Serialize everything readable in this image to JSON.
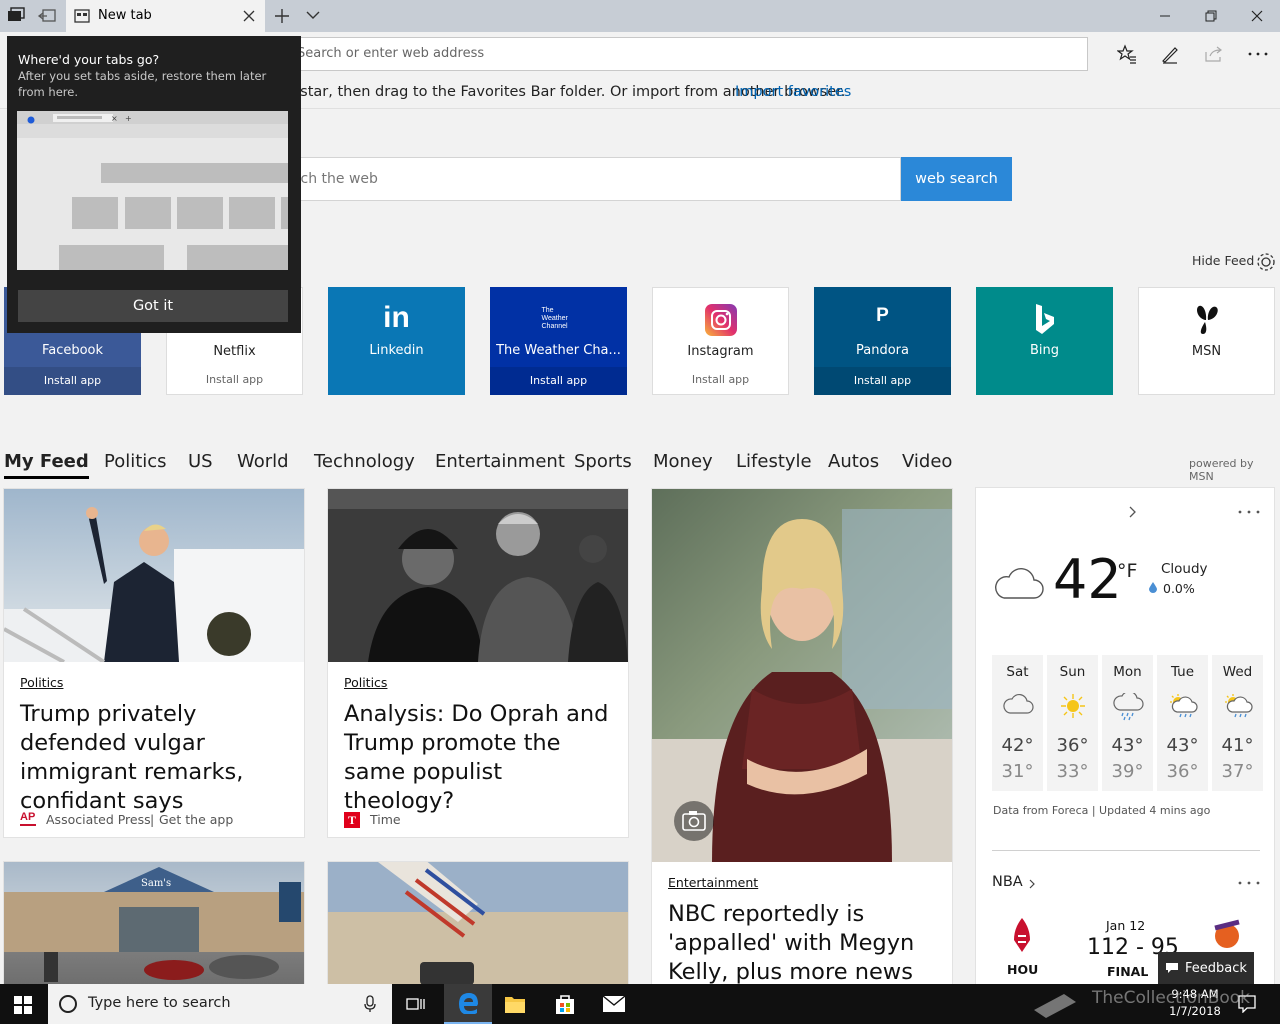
{
  "browser": {
    "tab_title": "New tab",
    "address_placeholder": "Search or enter web address",
    "favorites_message": "To show favorites here, select the star, then drag to the Favorites Bar folder. Or import from another browser.",
    "import_link": "Import favorites"
  },
  "flyout": {
    "title": "Where'd your tabs go?",
    "subtitle": "After you set tabs aside, restore them later from here.",
    "button": "Got it"
  },
  "search": {
    "placeholder": "Search the web",
    "button": "web search"
  },
  "hide_feed": "Hide Feed",
  "tiles": [
    {
      "name": "Facebook",
      "install": "Install app",
      "color": "#3b5998"
    },
    {
      "name": "Netflix",
      "install": "Install app",
      "color": "#ffffff"
    },
    {
      "name": "Linkedin",
      "install": "",
      "color": "#0a77b5"
    },
    {
      "name": "The Weather Cha...",
      "install": "Install app",
      "color": "#0131a5",
      "logo": "The Weather Channel"
    },
    {
      "name": "Instagram",
      "install": "Install app",
      "color": "#ffffff"
    },
    {
      "name": "Pandora",
      "install": "Install app",
      "color": "#005483"
    },
    {
      "name": "Bing",
      "install": "",
      "color": "#008b8b"
    },
    {
      "name": "MSN",
      "install": "",
      "color": "#ffffff"
    }
  ],
  "feed_nav": [
    "My Feed",
    "Politics",
    "US",
    "World",
    "Technology",
    "Entertainment",
    "Sports",
    "Money",
    "Lifestyle",
    "Autos",
    "Video"
  ],
  "powered_by": "powered by MSN",
  "cards": [
    {
      "category": "Politics",
      "headline": "Trump privately defended vulgar immigrant remarks, confidant says",
      "source": "Associated Press",
      "source_extra": "Get the app"
    },
    {
      "category": "Politics",
      "headline": "Analysis: Do Oprah and Trump promote the same populist theology?",
      "source": "Time"
    },
    {
      "category": "Entertainment",
      "headline": "NBC reportedly is 'appalled' with Megyn Kelly, plus more news"
    }
  ],
  "weather": {
    "temp": "42",
    "unit": "°F",
    "condition": "Cloudy",
    "precip": "0.0%",
    "attribution": "Data from Foreca | Updated 4 mins ago",
    "days": [
      {
        "day": "Sat",
        "hi": "42°",
        "lo": "31°",
        "icon": "cloud-icon"
      },
      {
        "day": "Sun",
        "hi": "36°",
        "lo": "33°",
        "icon": "sun-icon"
      },
      {
        "day": "Mon",
        "hi": "43°",
        "lo": "39°",
        "icon": "rain-cloud-icon"
      },
      {
        "day": "Tue",
        "hi": "43°",
        "lo": "36°",
        "icon": "partly-rain-icon"
      },
      {
        "day": "Wed",
        "hi": "41°",
        "lo": "37°",
        "icon": "partly-rain-icon"
      }
    ]
  },
  "nba": {
    "label": "NBA",
    "date": "Jan 12",
    "score": "112 - 95",
    "status": "FINAL",
    "home": "HOU"
  },
  "feedback": "Feedback",
  "taskbar": {
    "search_placeholder": "Type here to search",
    "time": "9:48 AM",
    "date": "1/7/2018"
  },
  "watermark": "TheCollectionBook"
}
